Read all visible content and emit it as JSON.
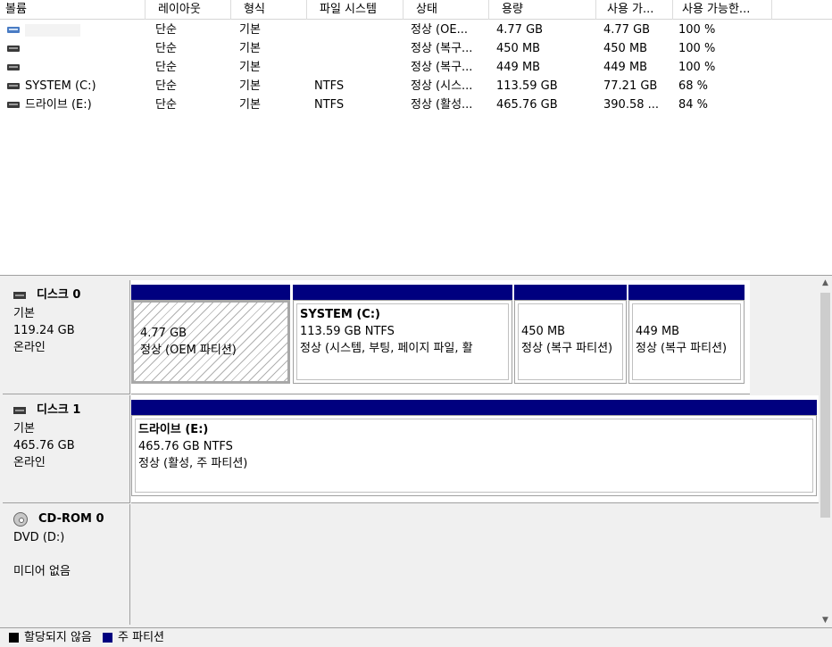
{
  "columns": [
    "볼륨",
    "레이아웃",
    "형식",
    "파일 시스템",
    "상태",
    "용량",
    "사용 가...",
    "사용 가능한..."
  ],
  "volumes": [
    {
      "name": "",
      "layout": "단순",
      "type": "기본",
      "fs": "",
      "status": "정상 (OE...",
      "capacity": "4.77 GB",
      "free": "4.77 GB",
      "pct": "100 %"
    },
    {
      "name": "",
      "layout": "단순",
      "type": "기본",
      "fs": "",
      "status": "정상 (복구...",
      "capacity": "450 MB",
      "free": "450 MB",
      "pct": "100 %"
    },
    {
      "name": "",
      "layout": "단순",
      "type": "기본",
      "fs": "",
      "status": "정상 (복구...",
      "capacity": "449 MB",
      "free": "449 MB",
      "pct": "100 %"
    },
    {
      "name": "SYSTEM (C:)",
      "layout": "단순",
      "type": "기본",
      "fs": "NTFS",
      "status": "정상 (시스...",
      "capacity": "113.59 GB",
      "free": "77.21 GB",
      "pct": "68 %"
    },
    {
      "name": "드라이브 (E:)",
      "layout": "단순",
      "type": "기본",
      "fs": "NTFS",
      "status": "정상 (활성...",
      "capacity": "465.76 GB",
      "free": "390.58 ...",
      "pct": "84 %"
    }
  ],
  "disks": [
    {
      "title": "디스크 0",
      "kind": "기본",
      "size": "119.24 GB",
      "state": "온라인",
      "partitions": [
        {
          "title": "",
          "line1": "4.77 GB",
          "line2": "정상 (OEM 파티션)"
        },
        {
          "title": "SYSTEM  (C:)",
          "line1": "113.59 GB NTFS",
          "line2": "정상 (시스템, 부팅, 페이지 파일, 활"
        },
        {
          "title": "",
          "line1": "450 MB",
          "line2": "정상 (복구 파티션)"
        },
        {
          "title": "",
          "line1": "449 MB",
          "line2": "정상 (복구 파티션)"
        }
      ]
    },
    {
      "title": "디스크 1",
      "kind": "기본",
      "size": "465.76 GB",
      "state": "온라인",
      "partitions": [
        {
          "title": "드라이브  (E:)",
          "line1": "465.76 GB NTFS",
          "line2": "정상 (활성, 주 파티션)"
        }
      ]
    },
    {
      "title": "CD-ROM 0",
      "kind": "DVD (D:)",
      "size": "",
      "state": "미디어 없음"
    }
  ],
  "legend": {
    "unallocated": "할당되지 않음",
    "primary": "주 파티션"
  },
  "colors": {
    "primary": "#00007f",
    "unallocated": "#000000"
  }
}
